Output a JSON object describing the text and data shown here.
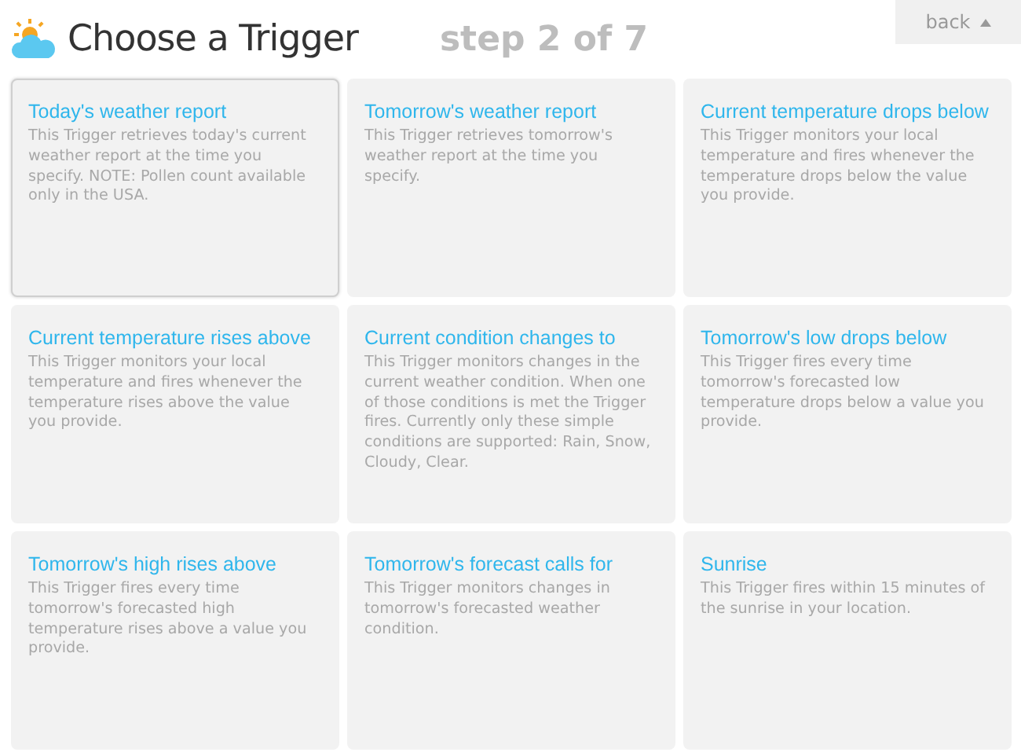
{
  "header": {
    "title": "Choose a Trigger",
    "step": "step 2 of 7",
    "back_button": "back"
  },
  "triggers": [
    {
      "title": "Today's weather report",
      "description": "This Trigger retrieves today's current weather report at the time you specify. NOTE: Pollen count available only in the USA.",
      "selected": true
    },
    {
      "title": "Tomorrow's weather report",
      "description": "This Trigger retrieves tomorrow's weather report at the time you specify.",
      "selected": false
    },
    {
      "title": "Current temperature drops below",
      "description": "This Trigger monitors your local temperature and fires whenever the temperature drops below the value you provide.",
      "selected": false
    },
    {
      "title": "Current temperature rises above",
      "description": "This Trigger monitors your local temperature and fires whenever the temperature rises above the value you provide.",
      "selected": false
    },
    {
      "title": "Current condition changes to",
      "description": "This Trigger monitors changes in the current weather condition. When one of those conditions is met the Trigger fires. Currently only these simple conditions are supported: Rain, Snow, Cloudy, Clear.",
      "selected": false
    },
    {
      "title": "Tomorrow's low drops below",
      "description": "This Trigger fires every time tomorrow's forecasted low temperature drops below a value you provide.",
      "selected": false
    },
    {
      "title": "Tomorrow's high rises above",
      "description": "This Trigger fires every time tomorrow's forecasted high temperature rises above a value you provide.",
      "selected": false
    },
    {
      "title": "Tomorrow's forecast calls for",
      "description": "This Trigger monitors changes in tomorrow's forecasted weather condition.",
      "selected": false
    },
    {
      "title": "Sunrise",
      "description": "This Trigger fires within 15 minutes of the sunrise in your location.",
      "selected": false
    }
  ]
}
